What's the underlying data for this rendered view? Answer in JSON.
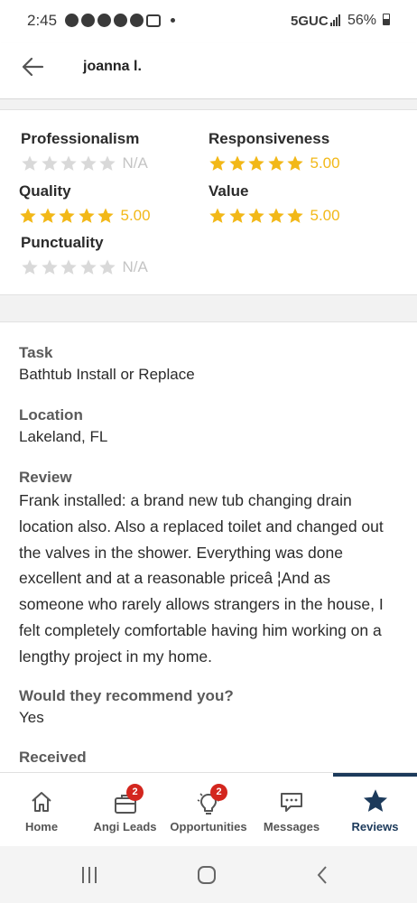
{
  "status_bar": {
    "time": "2:45",
    "network": "5GUC",
    "battery": "56%"
  },
  "header": {
    "title": "joanna l."
  },
  "ratings": [
    {
      "label": "Professionalism",
      "value": "N/A",
      "filled": 0
    },
    {
      "label": "Responsiveness",
      "value": "5.00",
      "filled": 5
    },
    {
      "label": "Quality",
      "value": "5.00",
      "filled": 5
    },
    {
      "label": "Value",
      "value": "5.00",
      "filled": 5
    },
    {
      "label": "Punctuality",
      "value": "N/A",
      "filled": 0
    }
  ],
  "details": {
    "task_label": "Task",
    "task_value": "Bathtub Install or Replace",
    "location_label": "Location",
    "location_value": "Lakeland, FL",
    "review_label": "Review",
    "review_value": "Frank installed: a brand new tub changing drain location also.  Also a replaced toilet and changed out the valves in the shower. Everything was done excellent and at a reasonable priceâ ¦And as someone who rarely allows strangers in the house, I felt completely comfortable having him working on a lengthy project in my home.",
    "recommend_label": "Would they recommend you?",
    "recommend_value": "Yes",
    "received_label": "Received"
  },
  "nav": {
    "items": [
      {
        "label": "Home",
        "icon": "home-icon"
      },
      {
        "label": "Angi Leads",
        "icon": "briefcase-icon",
        "badge": "2"
      },
      {
        "label": "Opportunities",
        "icon": "lightbulb-icon",
        "badge": "2"
      },
      {
        "label": "Messages",
        "icon": "chat-icon"
      },
      {
        "label": "Reviews",
        "icon": "star-icon"
      }
    ],
    "active": "Reviews"
  },
  "colors": {
    "star_on": "#f2b818",
    "star_off": "#d9d9d9",
    "nav_active": "#1c3a5b",
    "badge": "#d3261e"
  }
}
